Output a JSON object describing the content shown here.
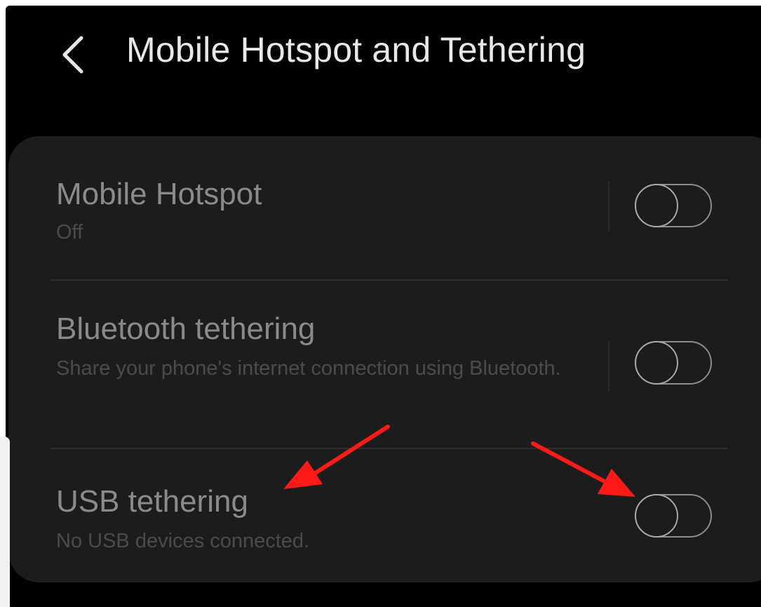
{
  "header": {
    "title": "Mobile Hotspot and Tethering",
    "back_icon": "chevron-left-icon"
  },
  "settings": [
    {
      "title": "Mobile Hotspot",
      "subtitle": "Off",
      "enabled": false
    },
    {
      "title": "Bluetooth tethering",
      "subtitle": "Share your phone's internet connection using Bluetooth.",
      "enabled": false
    },
    {
      "title": "USB tethering",
      "subtitle": "No USB devices connected.",
      "enabled": false
    }
  ],
  "colors": {
    "background": "#000000",
    "card": "#1c1c1c",
    "title_text": "#e8e8e8",
    "annotation_arrow": "#ff1a1a"
  }
}
